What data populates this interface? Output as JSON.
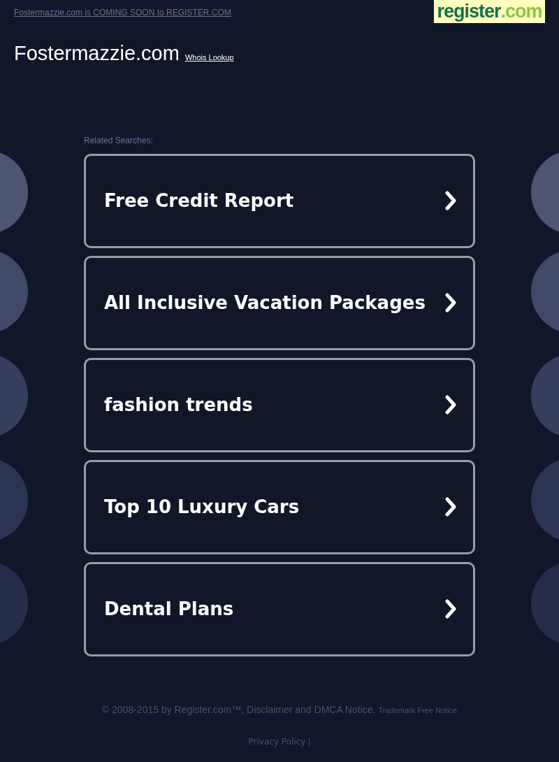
{
  "top_bar": {
    "notice_link": "Fostermazzie.com is COMING SOON to REGISTER.COM",
    "logo": {
      "name": "register",
      "suffix": ".com"
    }
  },
  "header": {
    "domain": "Fostermazzie.com",
    "whois_link": "Whois Lookup"
  },
  "related": {
    "label": "Related Searches:",
    "items": [
      {
        "label": "Free Credit Report"
      },
      {
        "label": "All Inclusive Vacation Packages"
      },
      {
        "label": "fashion trends"
      },
      {
        "label": "Top 10 Luxury Cars"
      },
      {
        "label": "Dental Plans"
      }
    ]
  },
  "footer": {
    "copyright": "© 2008-2015 by Register.com™, Disclaimer and DMCA Notice.",
    "trademark_link": "Trademark Free Notice",
    "privacy_link": "Privacy Policy",
    "separator": "|"
  }
}
